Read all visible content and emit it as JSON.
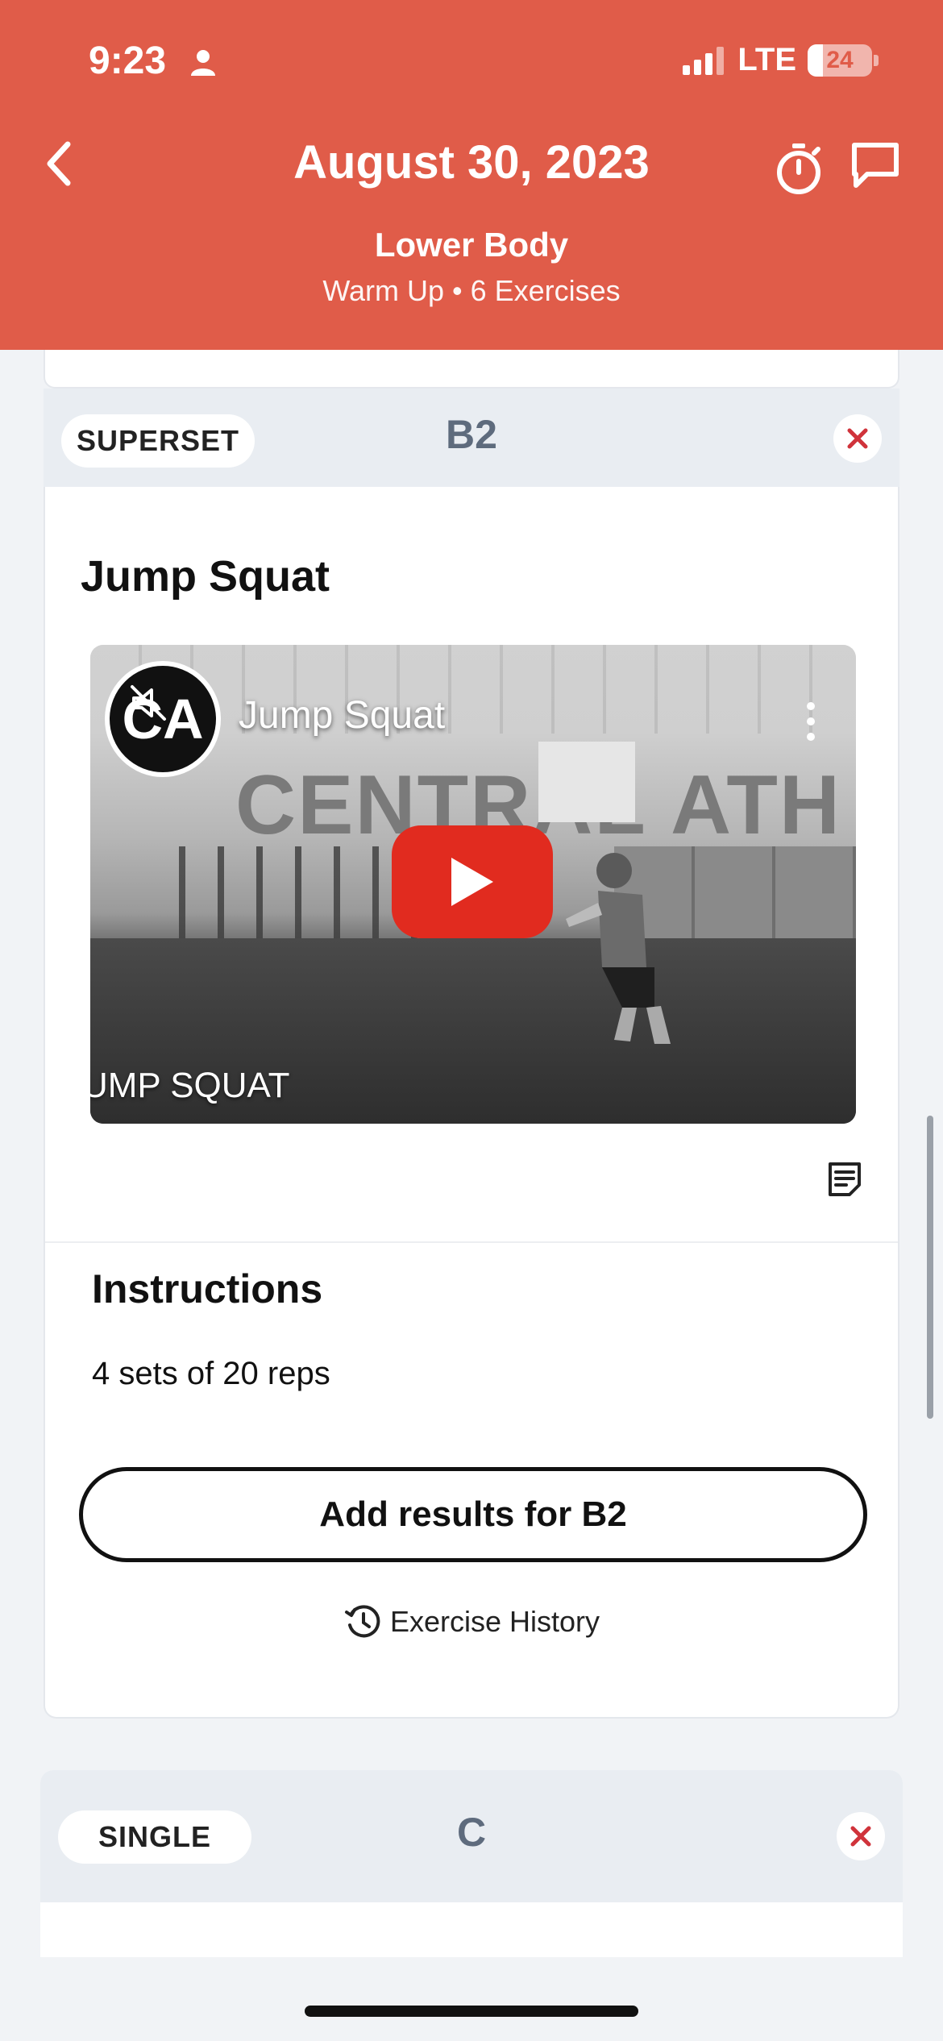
{
  "status_bar": {
    "time": "9:23",
    "network": "LTE",
    "battery": "24",
    "battery_level_percent": 24
  },
  "header": {
    "title": "August 30, 2023",
    "workout_name": "Lower Body",
    "workout_meta": "Warm Up • 6 Exercises",
    "back_icon": "chevron-left-icon",
    "timer_icon": "stopwatch-icon",
    "chat_icon": "chat-bubble-icon"
  },
  "group_b2": {
    "pill_label": "SUPERSET",
    "label": "B2"
  },
  "exercise": {
    "title": "Jump Squat",
    "video": {
      "title": "Jump Squat",
      "caption": "UMP SQUAT",
      "wall_text_left": "CENTRAL",
      "wall_text_right": "ATH",
      "channel_logo": "CA"
    },
    "instructions_title": "Instructions",
    "instructions_text": "4 sets of 20 reps",
    "add_results_label": "Add results for B2",
    "history_label": "Exercise History"
  },
  "group_c": {
    "pill_label": "SINGLE",
    "label": "C"
  },
  "colors": {
    "header_bg": "#e05c49",
    "remove_x": "#d0333b",
    "group_label": "#5e6b7d",
    "play_button": "#e12b1f"
  }
}
